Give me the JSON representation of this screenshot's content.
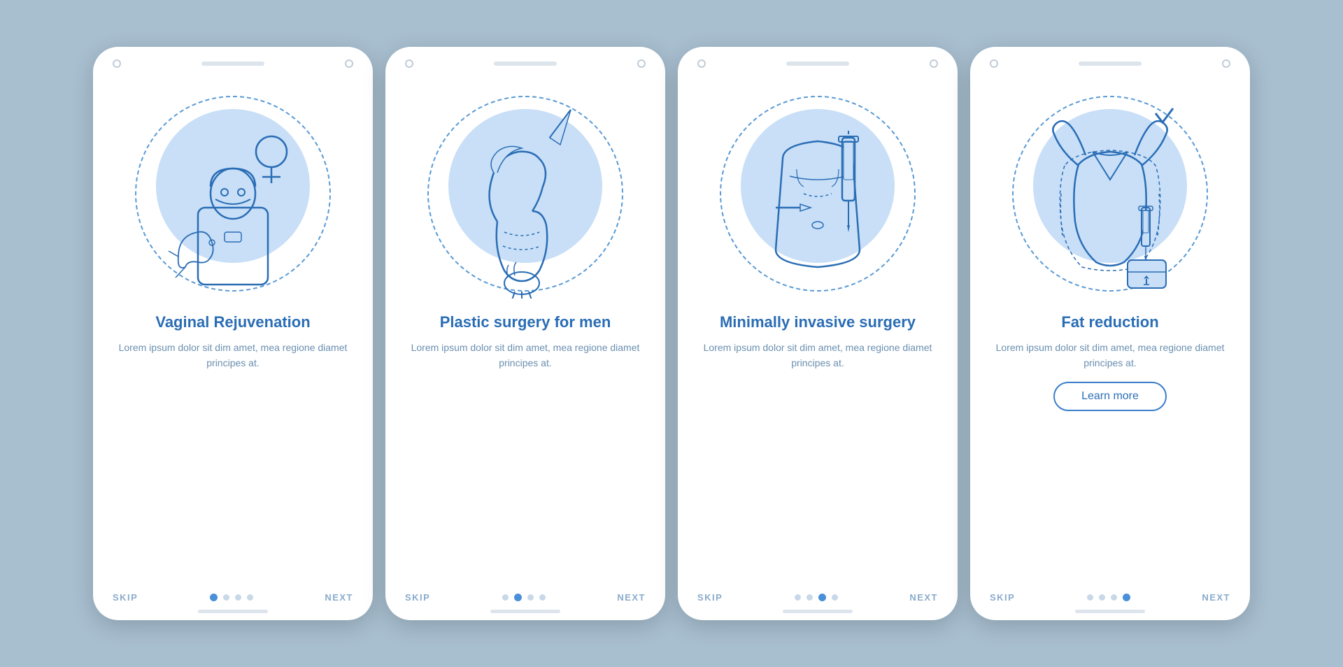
{
  "background_color": "#a8bfd0",
  "accent_color": "#2a6db5",
  "cards": [
    {
      "id": "vaginal-rejuvenation",
      "title": "Vaginal\nRejuvenation",
      "description": "Lorem ipsum dolor sit dim amet, mea regione diamet principes at.",
      "show_learn_more": false,
      "active_dot": 0,
      "dots": [
        true,
        false,
        false,
        false
      ],
      "nav": {
        "skip": "SKIP",
        "next": "NEXT"
      }
    },
    {
      "id": "plastic-surgery-men",
      "title": "Plastic\nsurgery for men",
      "description": "Lorem ipsum dolor sit dim amet, mea regione diamet principes at.",
      "show_learn_more": false,
      "active_dot": 1,
      "dots": [
        false,
        true,
        false,
        false
      ],
      "nav": {
        "skip": "SKIP",
        "next": "NEXT"
      }
    },
    {
      "id": "minimally-invasive",
      "title": "Minimally\ninvasive surgery",
      "description": "Lorem ipsum dolor sit dim amet, mea regione diamet principes at.",
      "show_learn_more": false,
      "active_dot": 2,
      "dots": [
        false,
        false,
        true,
        false
      ],
      "nav": {
        "skip": "SKIP",
        "next": "NEXT"
      }
    },
    {
      "id": "fat-reduction",
      "title": "Fat reduction",
      "description": "Lorem ipsum dolor sit dim amet, mea regione diamet principes at.",
      "show_learn_more": true,
      "learn_more_label": "Learn more",
      "active_dot": 3,
      "dots": [
        false,
        false,
        false,
        true
      ],
      "nav": {
        "skip": "SKIP",
        "next": "NEXT"
      }
    }
  ]
}
